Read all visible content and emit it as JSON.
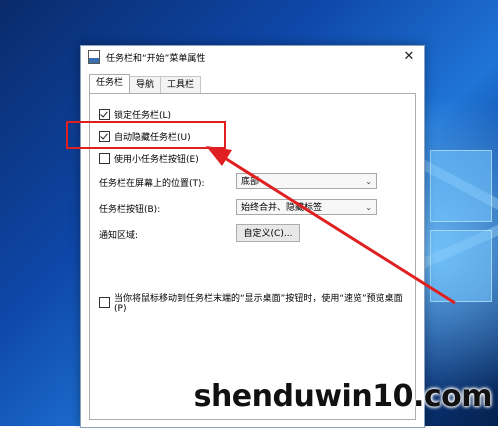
{
  "dialog": {
    "title": "任务栏和“开始”菜单属性",
    "close_glyph": "✕",
    "tabs": [
      {
        "label": "任务栏",
        "active": true
      },
      {
        "label": "导航",
        "active": false
      },
      {
        "label": "工具栏",
        "active": false
      }
    ]
  },
  "taskbar_tab": {
    "lock_taskbar": {
      "label": "锁定任务栏(L)",
      "checked": true
    },
    "auto_hide": {
      "label": "自动隐藏任务栏(U)",
      "checked": true
    },
    "small_buttons": {
      "label": "使用小任务栏按钮(E)",
      "checked": false
    },
    "location_label": "任务栏在屏幕上的位置(T):",
    "location_value": "底部",
    "buttons_label": "任务栏按钮(B):",
    "buttons_value": "始终合并、隐藏标签",
    "notify_label": "通知区域:",
    "customize_button": "自定义(C)...",
    "peek": {
      "label": "当你将鼠标移动到任务栏末端的“显示桌面”按钮时，使用“速览”预览桌面(P)",
      "checked": false
    }
  },
  "watermark": "shenduwin10.com",
  "colors": {
    "highlight": "#e02020",
    "arrow": "#e02020"
  }
}
